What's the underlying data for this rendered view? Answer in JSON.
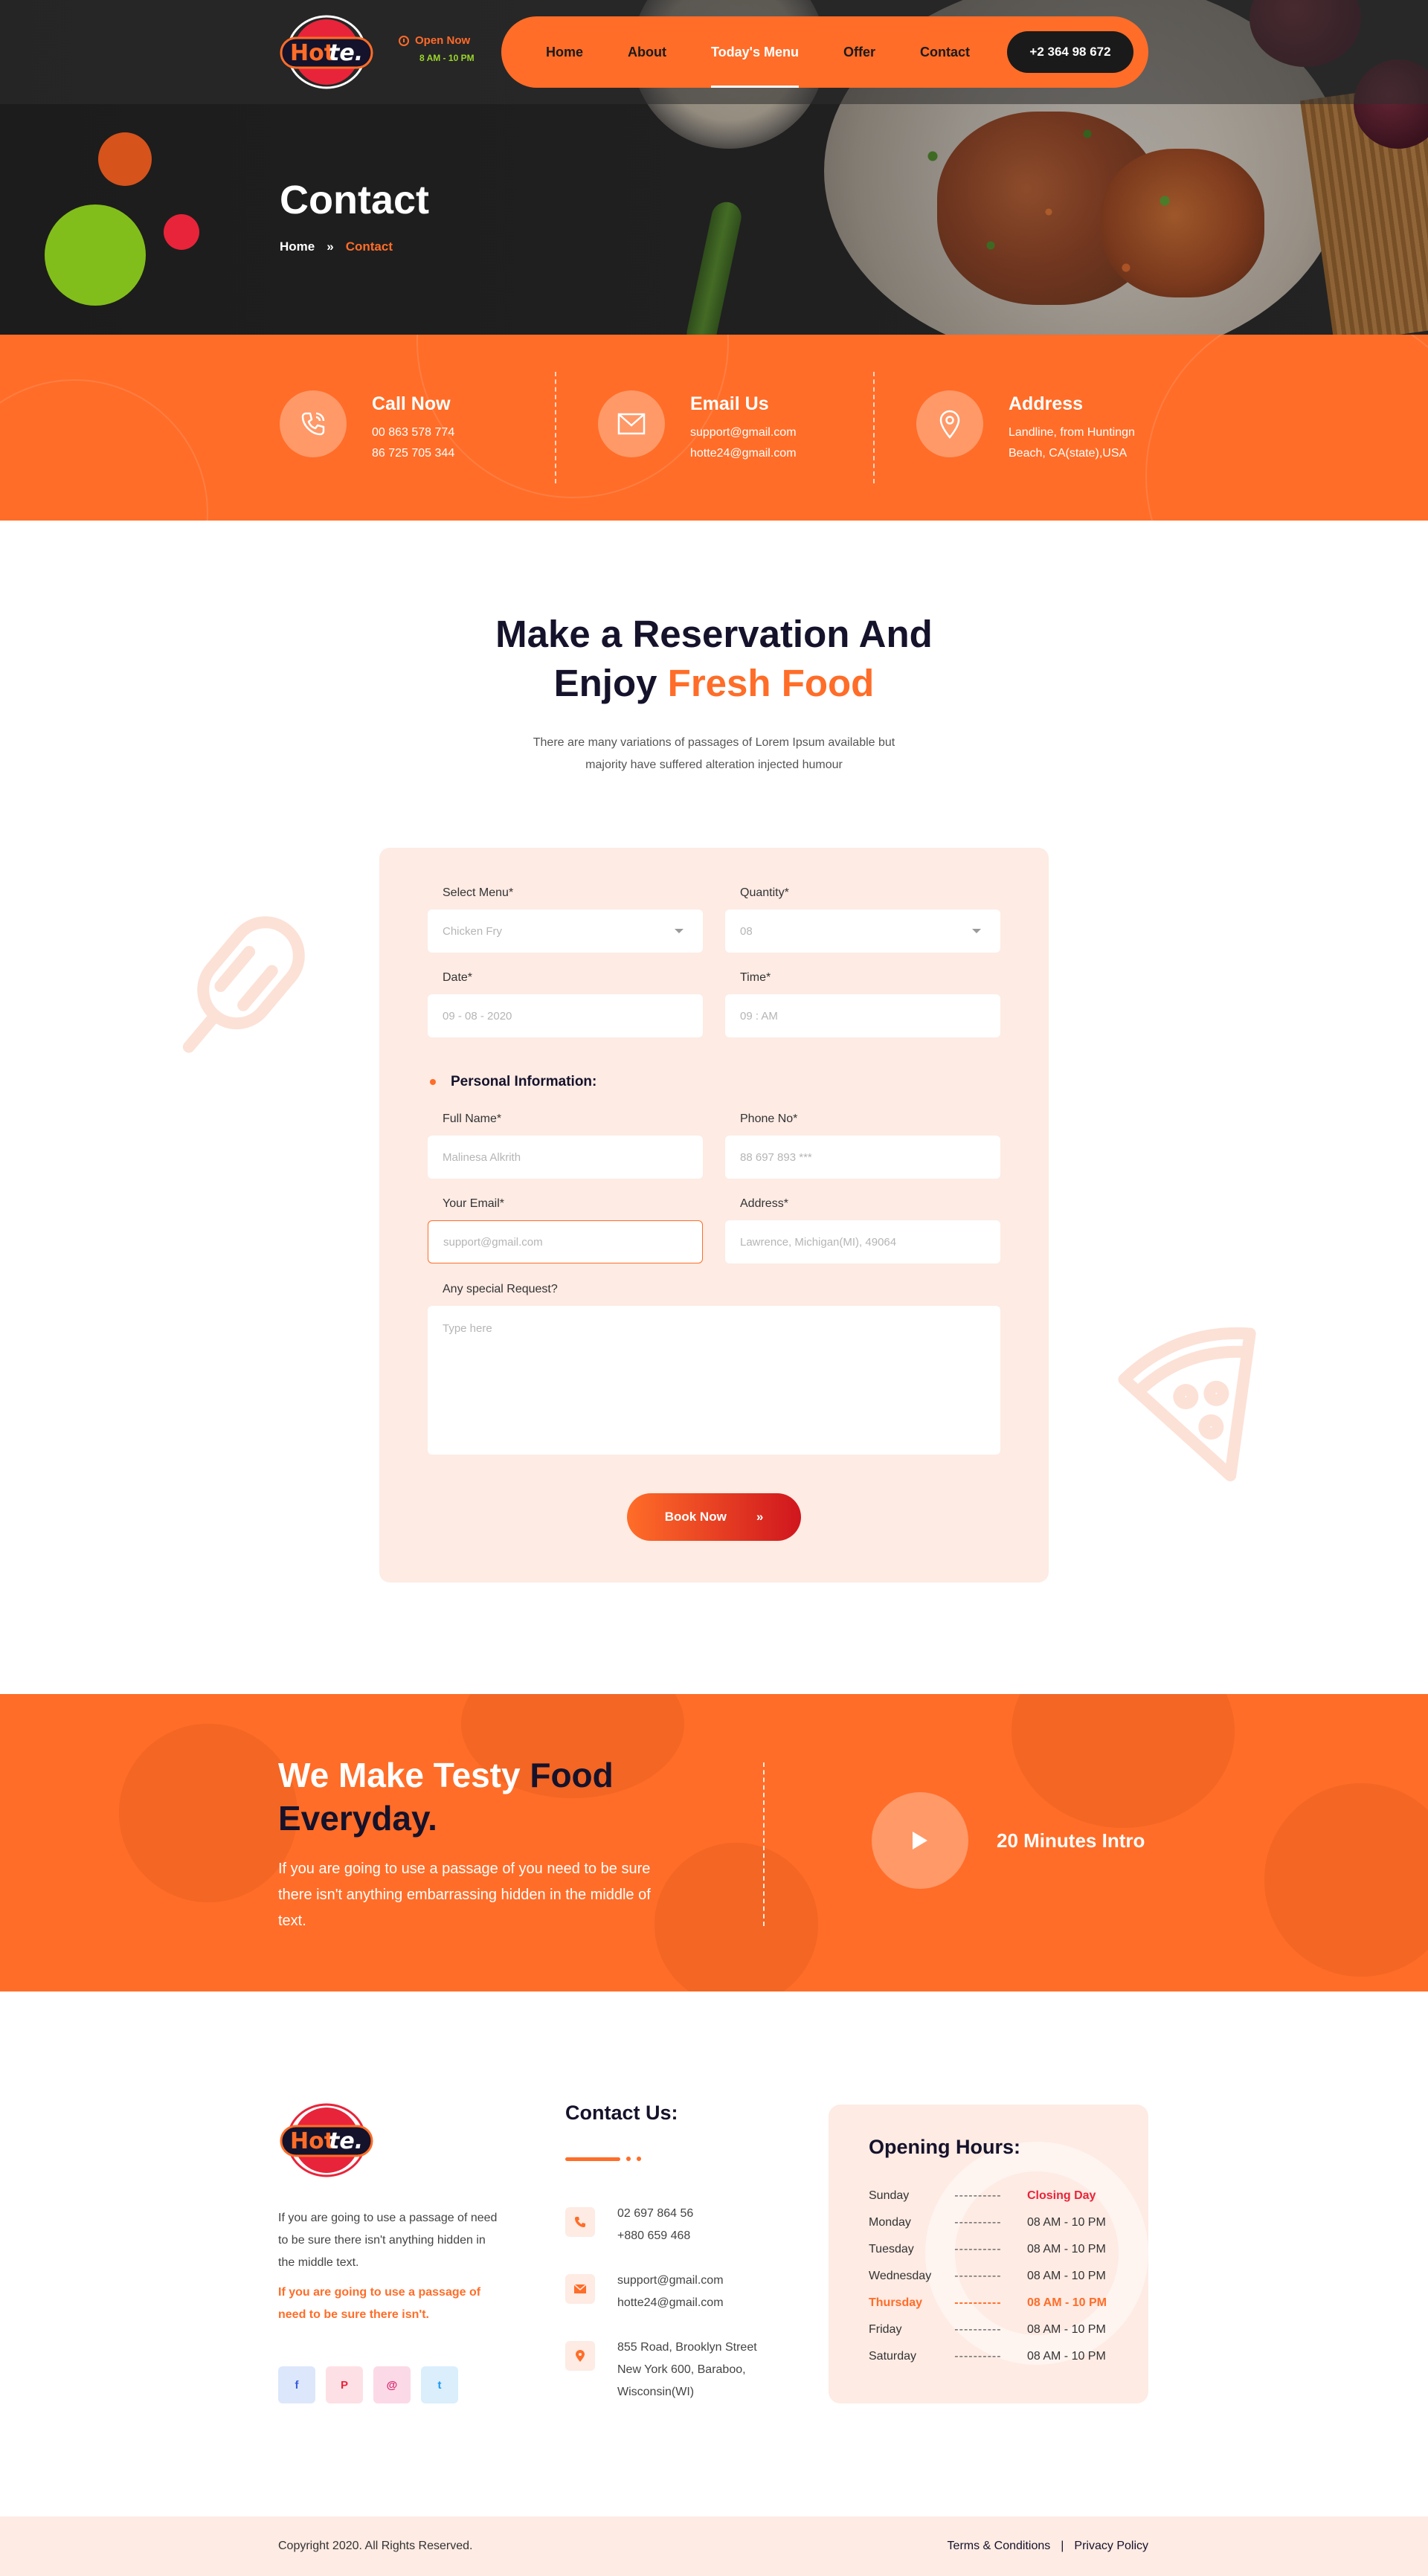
{
  "brand": {
    "logo_text_a": "Hot",
    "logo_text_b": "te."
  },
  "header": {
    "open_label": "Open Now",
    "open_hours": "8 AM  -  10 PM",
    "nav": [
      "Home",
      "About",
      "Today's Menu",
      "Offer",
      "Contact"
    ],
    "active_nav": "Today's Menu",
    "phone": "+2 364 98 672"
  },
  "hero": {
    "title": "Contact",
    "breadcrumb_home": "Home",
    "breadcrumb_sep": "»",
    "breadcrumb_current": "Contact"
  },
  "info": {
    "call": {
      "title": "Call Now",
      "line1": "00 863 578 774",
      "line2": "86 725 705 344",
      "icon": "phone-icon"
    },
    "email": {
      "title": "Email Us",
      "line1": "support@gmail.com",
      "line2": "hotte24@gmail.com",
      "icon": "envelope-icon"
    },
    "address": {
      "title": "Address",
      "line1": "Landline, from Huntingn",
      "line2": "Beach, CA(state),USA",
      "icon": "map-pin-icon"
    }
  },
  "reservation": {
    "heading_line1": "Make a Reservation And",
    "heading_line2_a": "Enjoy ",
    "heading_line2_b": "Fresh Food",
    "desc_line1": "There are many variations of passages of Lorem Ipsum available but",
    "desc_line2": "majority have suffered alteration injected humour"
  },
  "form": {
    "menu_label": "Select Menu*",
    "menu_value": "Chicken Fry",
    "quantity_label": "Quantity*",
    "quantity_value": "08",
    "date_label": "Date*",
    "date_value": "09 - 08 - 2020",
    "time_label": "Time*",
    "time_value": "09 : AM",
    "personal_title": "Personal Information:",
    "name_label": "Full Name*",
    "name_placeholder": "Malinesa Alkrith",
    "phone_label": "Phone No*",
    "phone_placeholder": "88 697 893 ***",
    "email_label": "Your Email*",
    "email_placeholder": "support@gmail.com",
    "address_label": "Address*",
    "address_placeholder": "Lawrence, Michigan(MI), 49064",
    "request_label": "Any special Request?",
    "request_placeholder": "Type here",
    "submit_label": "Book Now",
    "submit_arrow": "»"
  },
  "promo": {
    "title_a": "We Make Testy ",
    "title_b": "Food",
    "title_c": "Everyday.",
    "desc": "If you are going to use a passage of you need to be sure there isn't anything embarrassing hidden in the middle of text.",
    "video_label": "20 Minutes Intro"
  },
  "footer": {
    "about": "If you are going to use a passage of need to be sure there isn't anything hidden in the middle text.",
    "about_accent": "If you are going to use a passage of need to be sure there isn't.",
    "socials": [
      {
        "name": "facebook",
        "glyph": "f",
        "bg": "#dde7fb",
        "color": "#3b5bdb"
      },
      {
        "name": "pinterest",
        "glyph": "P",
        "bg": "#fde0e6",
        "color": "#e8243a"
      },
      {
        "name": "instagram",
        "glyph": "@",
        "bg": "#fcd9e6",
        "color": "#d6246e"
      },
      {
        "name": "twitter",
        "glyph": "t",
        "bg": "#daeefc",
        "color": "#1d9bf0"
      }
    ],
    "contact_title": "Contact Us:",
    "contact_phone_1": "02 697 864 56",
    "contact_phone_2": "+880 659 468",
    "contact_email_1": "support@gmail.com",
    "contact_email_2": "hotte24@gmail.com",
    "contact_address_1": "855 Road, Brooklyn Street",
    "contact_address_2": "New York 600, Baraboo,",
    "contact_address_3": "Wisconsin(WI)",
    "hours_title": "Opening Hours:",
    "hours": [
      {
        "day": "Sunday",
        "dash": "----------",
        "time": "Closing Day"
      },
      {
        "day": "Monday",
        "dash": "----------",
        "time": "08 AM - 10 PM"
      },
      {
        "day": "Tuesday",
        "dash": "----------",
        "time": "08 AM - 10 PM"
      },
      {
        "day": "Wednesday",
        "dash": "----------",
        "time": "08 AM - 10 PM"
      },
      {
        "day": "Thursday",
        "dash": "----------",
        "time": "08 AM - 10 PM"
      },
      {
        "day": "Friday",
        "dash": "----------",
        "time": "08 AM - 10 PM"
      },
      {
        "day": "Saturday",
        "dash": "----------",
        "time": "08 AM - 10 PM"
      }
    ],
    "copyright": "Copyright 2020. All Rights Reserved.",
    "terms": "Terms & Conditions",
    "legal_sep": "|",
    "privacy": "Privacy Policy"
  },
  "colors": {
    "accent": "#ff6d28",
    "dark": "#15122b",
    "cream": "#fdebe4",
    "green": "#82be1b",
    "red": "#e8243a"
  }
}
